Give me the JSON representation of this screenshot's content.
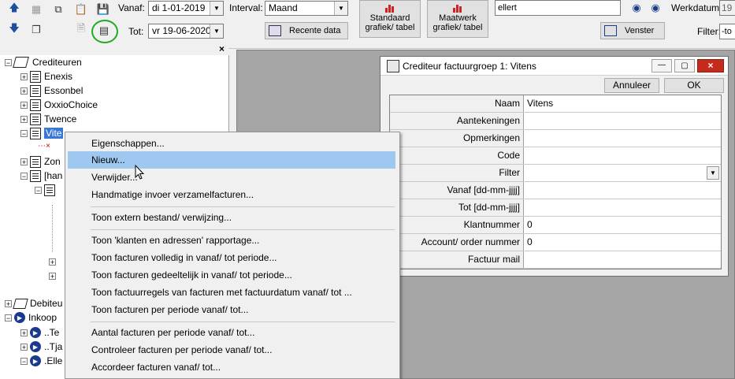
{
  "toolbar": {
    "vanaf_label": "Vanaf:",
    "vanaf_value": "di   1-01-2019",
    "interval_label": "Interval:",
    "interval_value": "Maand",
    "tot_label": "Tot:",
    "tot_value": "vr  19-06-2020",
    "recente_data": "Recente data",
    "standaard_line1": "Standaard",
    "standaard_line2": "grafiek/ tabel",
    "maatwerk_line1": "Maatwerk",
    "maatwerk_line2": "grafiek/ tabel",
    "search_value": "ellert",
    "werkdatum_label": "Werkdatum:",
    "werkdatum_value": "19",
    "venster": "Venster",
    "filter_label": "Filter:",
    "filter_value": "-to"
  },
  "tree": {
    "root": "Crediteuren",
    "items": [
      {
        "label": "Enexis"
      },
      {
        "label": "Essonbel"
      },
      {
        "label": "OxxioChoice"
      },
      {
        "label": "Twence"
      },
      {
        "label": "Vite"
      },
      {
        "label": "Zon"
      },
      {
        "label": "[han"
      }
    ],
    "debiteuren": "Debiteu",
    "inkoop": "Inkoop",
    "sub": [
      {
        "label": "..Te"
      },
      {
        "label": "..Tja"
      },
      {
        "label": ".Elle"
      }
    ]
  },
  "context_menu": {
    "items": [
      {
        "label": "Eigenschappen..."
      },
      {
        "label": "Nieuw..."
      },
      {
        "label": "Verwijder..."
      },
      {
        "label": "Handmatige invoer verzamelfacturen..."
      },
      {
        "label": "Toon extern bestand/ verwijzing..."
      },
      {
        "label": "Toon 'klanten en adressen' rapportage..."
      },
      {
        "label": "Toon facturen volledig in vanaf/ tot periode..."
      },
      {
        "label": "Toon facturen gedeeltelijk in vanaf/ tot periode..."
      },
      {
        "label": "Toon factuurregels van facturen met factuurdatum vanaf/ tot ..."
      },
      {
        "label": "Toon facturen per periode vanaf/ tot..."
      },
      {
        "label": "Aantal facturen per periode vanaf/ tot..."
      },
      {
        "label": "Controleer facturen per periode vanaf/ tot..."
      },
      {
        "label": "Accordeer facturen vanaf/ tot..."
      }
    ]
  },
  "dialog": {
    "title": "Crediteur factuurgroep 1: Vitens",
    "annuleer": "Annuleer",
    "ok": "OK",
    "fields": [
      {
        "key": "Naam",
        "value": "Vitens"
      },
      {
        "key": "Aantekeningen",
        "value": ""
      },
      {
        "key": "Opmerkingen",
        "value": ""
      },
      {
        "key": "Code",
        "value": ""
      },
      {
        "key": "Filter",
        "value": ""
      },
      {
        "key": "Vanaf [dd-mm-jjjj]",
        "value": ""
      },
      {
        "key": "Tot [dd-mm-jjjj]",
        "value": ""
      },
      {
        "key": "Klantnummer",
        "value": "0"
      },
      {
        "key": "Account/ order nummer",
        "value": "0"
      },
      {
        "key": "Factuur mail",
        "value": ""
      }
    ]
  },
  "colors": {
    "highlight": "#9ec8f0",
    "titlebar_close": "#c42b1c",
    "green_circle": "#22aa22"
  }
}
